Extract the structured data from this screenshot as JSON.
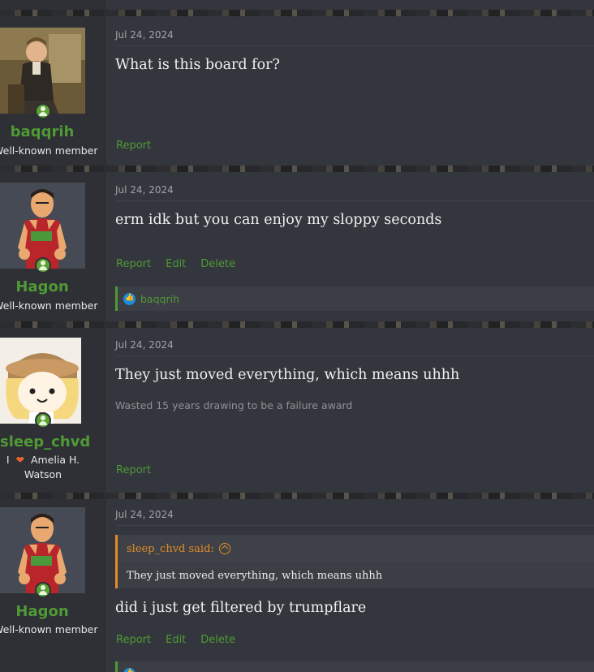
{
  "posts": [
    {
      "username": "baqqrih",
      "user_title": "Well-known member",
      "date": "Jul 24, 2024",
      "body": "What is this board for?",
      "actions": [
        "Report"
      ]
    },
    {
      "username": "Hagon",
      "user_title": "Well-known member",
      "date": "Jul 24, 2024",
      "body": "erm idk but you can enjoy my sloppy seconds",
      "actions": [
        "Report",
        "Edit",
        "Delete"
      ],
      "reaction": {
        "icon": "like-icon",
        "users": "baqqrih"
      }
    },
    {
      "username": "sleep_chvd",
      "user_title_prefix": "I",
      "user_title_heart": "❤",
      "user_title_line1": "Amelia H.",
      "user_title_line2": "Watson",
      "date": "Jul 24, 2024",
      "body": "They just moved everything, which means uhhh",
      "signature": "Wasted 15 years drawing to be a failure award",
      "actions": [
        "Report"
      ]
    },
    {
      "username": "Hagon",
      "user_title": "Well-known member",
      "date": "Jul 24, 2024",
      "quote": {
        "author": "sleep_chvd said:",
        "text": "They just moved everything, which means uhhh"
      },
      "body": "did i just get filtered by trumpflare",
      "actions": [
        "Report",
        "Edit",
        "Delete"
      ]
    }
  ],
  "colors": {
    "accent": "#4f9a35",
    "quote": "#e48a27",
    "background": "#34363d"
  }
}
